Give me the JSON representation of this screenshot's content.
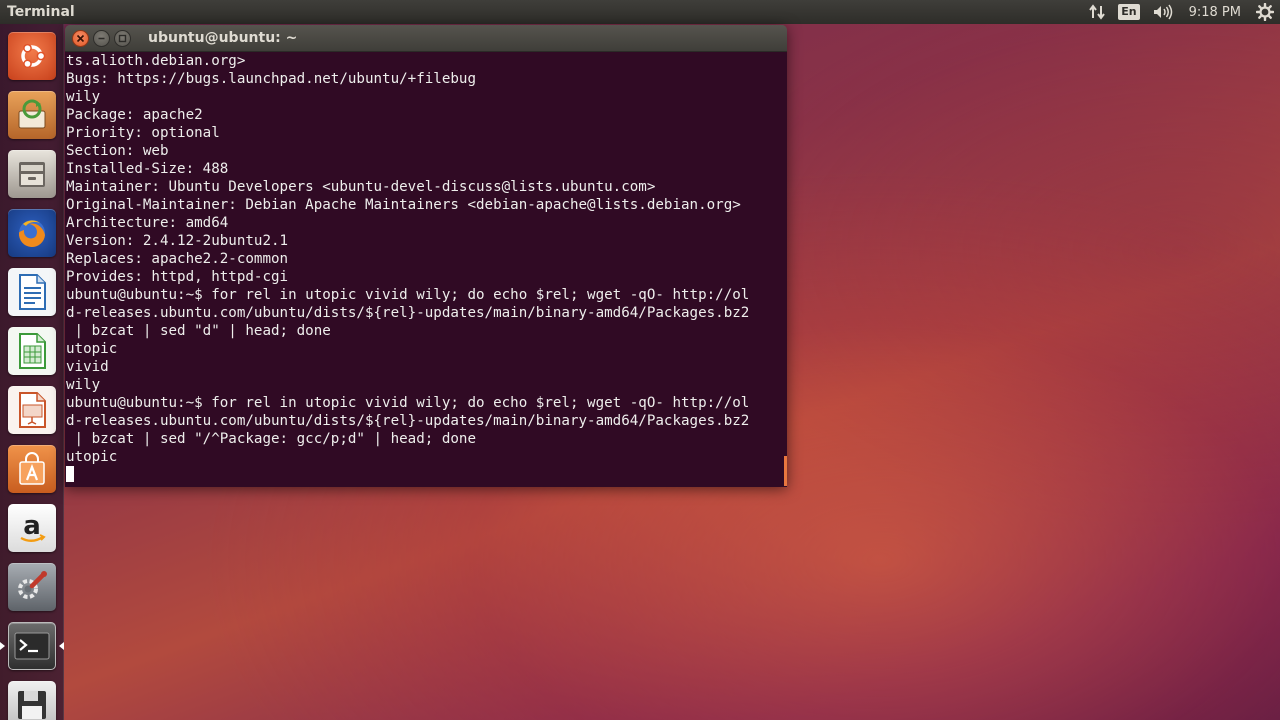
{
  "top_panel": {
    "app_title": "Terminal",
    "keyboard_layout": "En",
    "clock": "9:18 PM",
    "indicators": [
      "network-arrows-icon",
      "keyboard-layout-badge",
      "volume-icon",
      "clock",
      "settings-gear-icon"
    ]
  },
  "launcher": {
    "items": [
      {
        "name": "ubuntu-dash",
        "icon": "ubuntu-logo-icon",
        "color": "#e9532c"
      },
      {
        "name": "software-updater",
        "icon": "software-updater-icon",
        "color": "#d98a3c"
      },
      {
        "name": "files",
        "icon": "file-cabinet-icon",
        "color": "#b8b3aa"
      },
      {
        "name": "firefox",
        "icon": "firefox-icon",
        "color": "#e56b1f"
      },
      {
        "name": "libreoffice-writer",
        "icon": "writer-document-icon",
        "color": "#2e6db4"
      },
      {
        "name": "libreoffice-calc",
        "icon": "calc-spreadsheet-icon",
        "color": "#3c9a3a"
      },
      {
        "name": "libreoffice-impress",
        "icon": "impress-presentation-icon",
        "color": "#c9552a"
      },
      {
        "name": "ubuntu-software-center",
        "icon": "shopping-bag-icon",
        "color": "#e47a2e"
      },
      {
        "name": "amazon",
        "icon": "amazon-logo-icon",
        "color": "#f2f2f2"
      },
      {
        "name": "system-settings",
        "icon": "wrench-gear-icon",
        "color": "#8a8f96"
      },
      {
        "name": "terminal",
        "icon": "terminal-prompt-icon",
        "color": "#3b3b3b"
      },
      {
        "name": "save-device",
        "icon": "floppy-disk-icon",
        "color": "#d8d8d8"
      }
    ]
  },
  "window": {
    "title": "ubuntu@ubuntu: ~",
    "buttons": [
      "close",
      "minimize",
      "maximize"
    ]
  },
  "terminal": {
    "lines": [
      "ts.alioth.debian.org>",
      "Bugs: https://bugs.launchpad.net/ubuntu/+filebug",
      "wily",
      "Package: apache2",
      "Priority: optional",
      "Section: web",
      "Installed-Size: 488",
      "Maintainer: Ubuntu Developers <ubuntu-devel-discuss@lists.ubuntu.com>",
      "Original-Maintainer: Debian Apache Maintainers <debian-apache@lists.debian.org>",
      "Architecture: amd64",
      "Version: 2.4.12-2ubuntu2.1",
      "Replaces: apache2.2-common",
      "Provides: httpd, httpd-cgi",
      "ubuntu@ubuntu:~$ for rel in utopic vivid wily; do echo $rel; wget -qO- http://ol",
      "d-releases.ubuntu.com/ubuntu/dists/${rel}-updates/main/binary-amd64/Packages.bz2",
      " | bzcat | sed \"d\" | head; done",
      "utopic",
      "vivid",
      "wily",
      "ubuntu@ubuntu:~$ for rel in utopic vivid wily; do echo $rel; wget -qO- http://ol",
      "d-releases.ubuntu.com/ubuntu/dists/${rel}-updates/main/binary-amd64/Packages.bz2",
      " | bzcat | sed \"/^Package: gcc/p;d\" | head; done",
      "utopic"
    ],
    "colors": {
      "background": "#300a24",
      "foreground": "#eeeeec",
      "cursor": "#ffffff"
    }
  }
}
